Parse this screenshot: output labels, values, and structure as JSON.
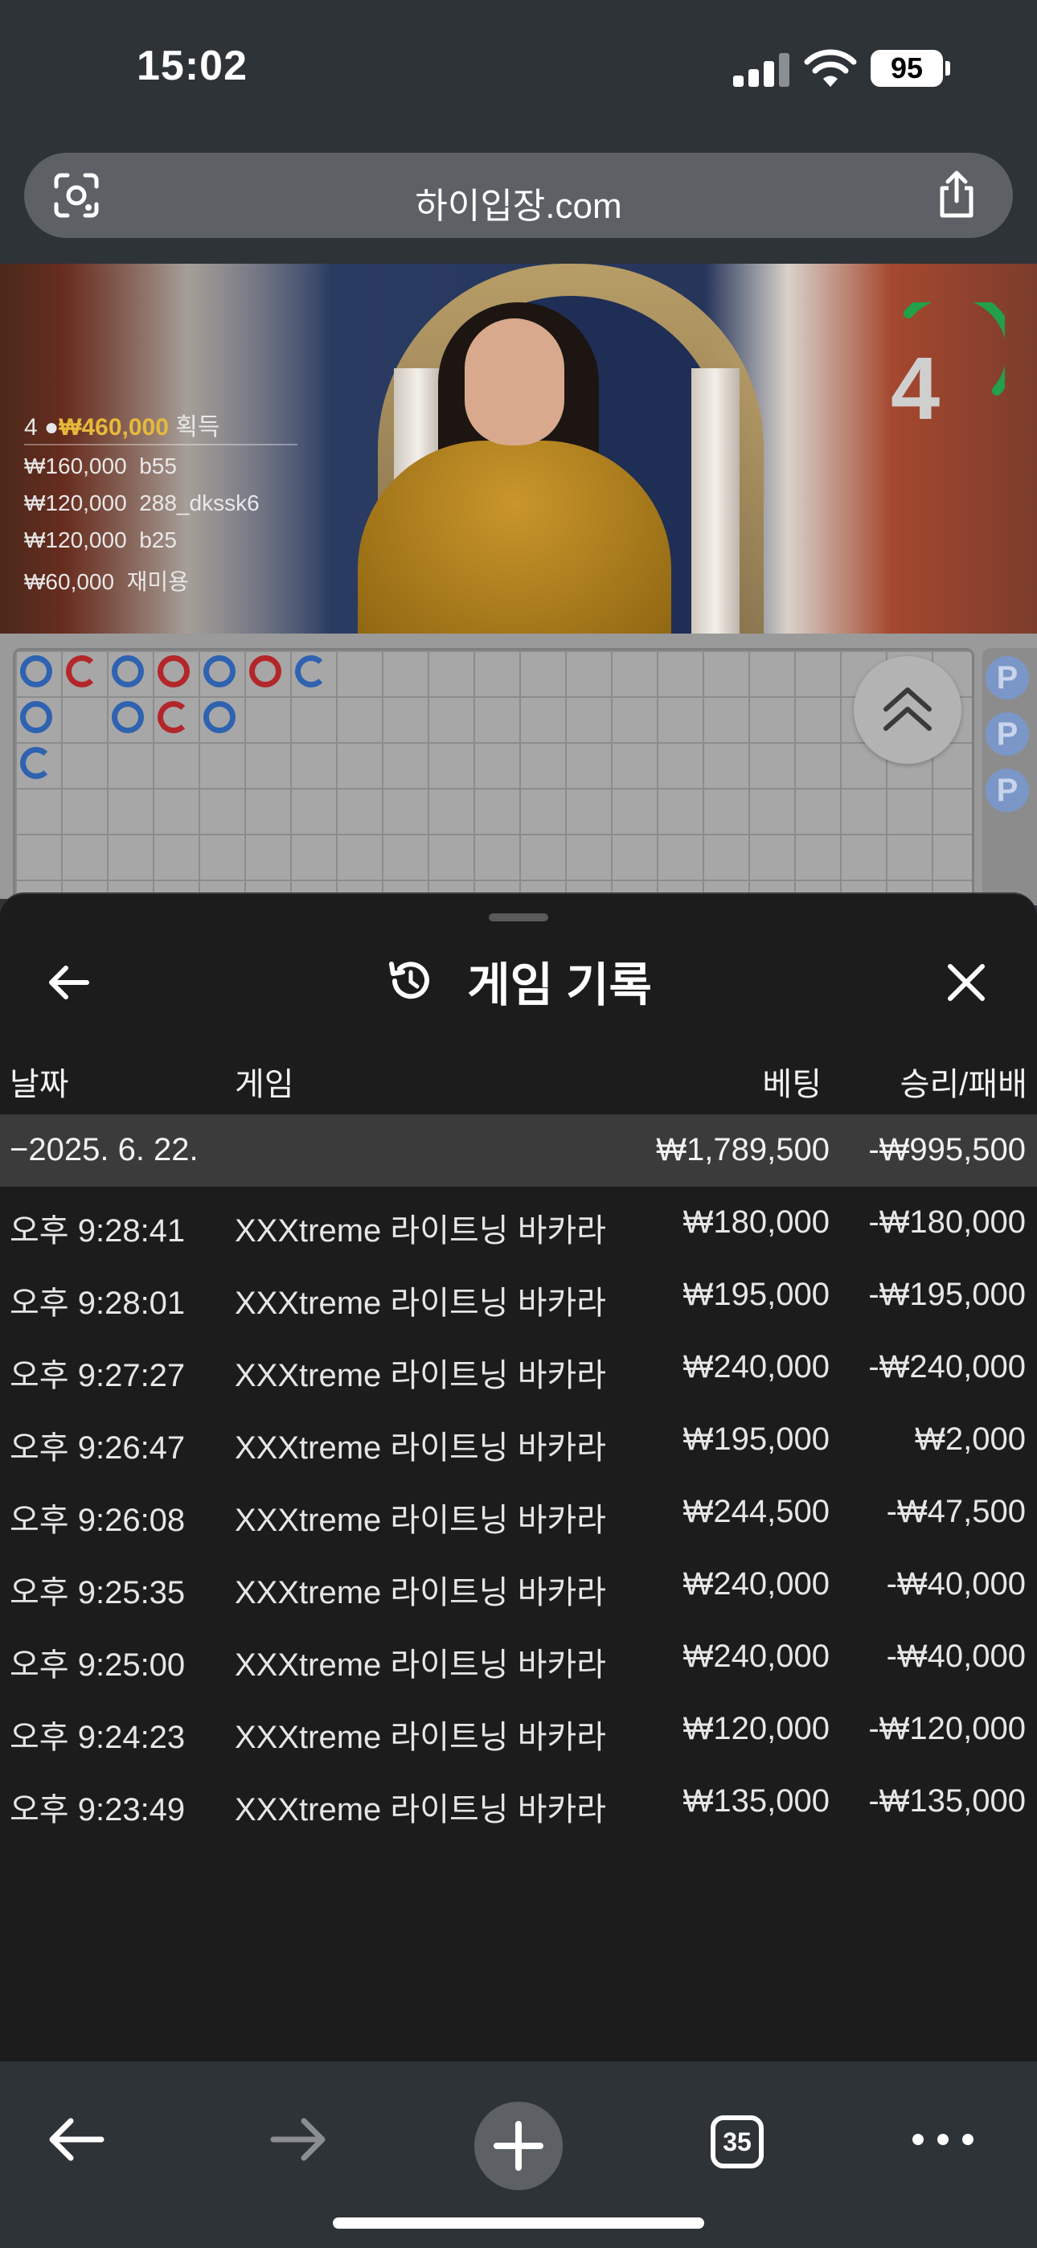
{
  "status_bar": {
    "time": "15:02",
    "battery": "95"
  },
  "browser": {
    "url": "하이입장.com",
    "tab_count": "35"
  },
  "video": {
    "timer": "4",
    "winners_header": {
      "count": "4",
      "amount": "₩460,000",
      "label": "획득"
    },
    "winners": [
      {
        "amount": "₩160,000",
        "name": "b55"
      },
      {
        "amount": "₩120,000",
        "name": "288_dkssk6"
      },
      {
        "amount": "₩120,000",
        "name": "b25"
      },
      {
        "amount": "₩60,000",
        "name": "재미용"
      }
    ],
    "side_labels": [
      "P",
      "P",
      "P"
    ]
  },
  "history": {
    "title": "게임 기록",
    "columns": {
      "date": "날짜",
      "game": "게임",
      "bet": "베팅",
      "result": "승리/패배"
    },
    "summary": {
      "date": "−2025. 6. 22.",
      "bet": "₩1,789,500",
      "result": "-₩995,500"
    },
    "rows": [
      {
        "time": "오후 9:28:41",
        "game": "XXXtreme 라이트닝 바카라",
        "bet": "₩180,000",
        "result": "-₩180,000"
      },
      {
        "time": "오후 9:28:01",
        "game": "XXXtreme 라이트닝 바카라",
        "bet": "₩195,000",
        "result": "-₩195,000"
      },
      {
        "time": "오후 9:27:27",
        "game": "XXXtreme 라이트닝 바카라",
        "bet": "₩240,000",
        "result": "-₩240,000"
      },
      {
        "time": "오후 9:26:47",
        "game": "XXXtreme 라이트닝 바카라",
        "bet": "₩195,000",
        "result": "₩2,000"
      },
      {
        "time": "오후 9:26:08",
        "game": "XXXtreme 라이트닝 바카라",
        "bet": "₩244,500",
        "result": "-₩47,500"
      },
      {
        "time": "오후 9:25:35",
        "game": "XXXtreme 라이트닝 바카라",
        "bet": "₩240,000",
        "result": "-₩40,000"
      },
      {
        "time": "오후 9:25:00",
        "game": "XXXtreme 라이트닝 바카라",
        "bet": "₩240,000",
        "result": "-₩40,000"
      },
      {
        "time": "오후 9:24:23",
        "game": "XXXtreme 라이트닝 바카라",
        "bet": "₩120,000",
        "result": "-₩120,000"
      },
      {
        "time": "오후 9:23:49",
        "game": "XXXtreme 라이트닝 바카라",
        "bet": "₩135,000",
        "result": "-₩135,000"
      }
    ]
  }
}
